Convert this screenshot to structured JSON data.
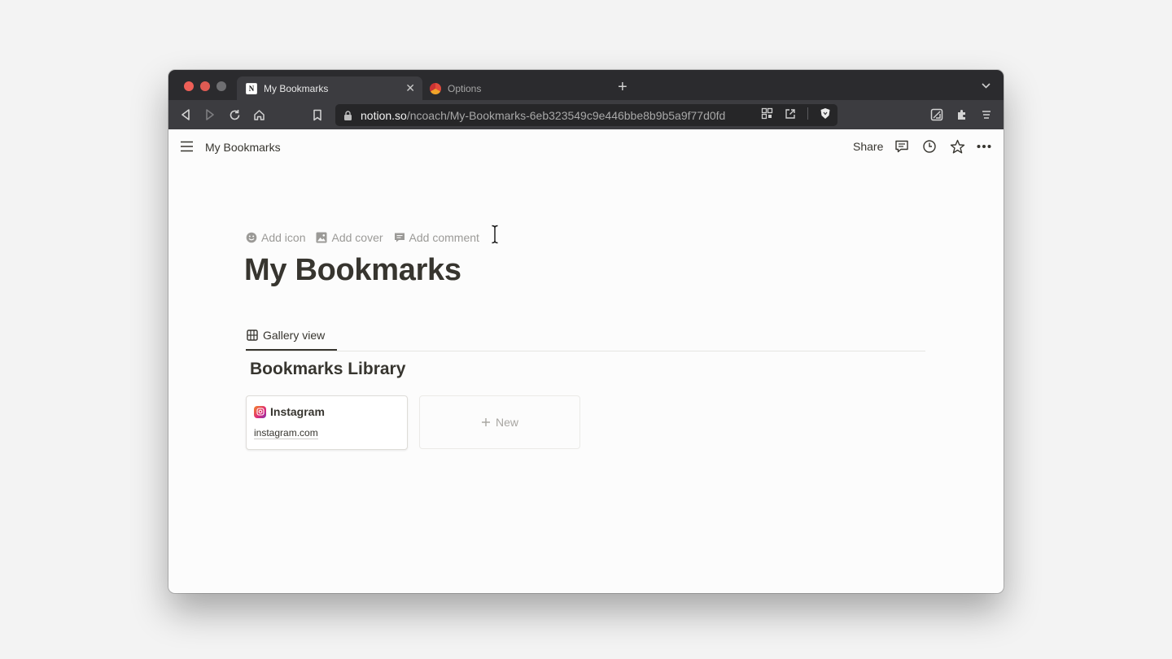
{
  "browser": {
    "tabs": [
      {
        "title": "My Bookmarks",
        "active": true,
        "favicon": "notion-icon"
      },
      {
        "title": "Options",
        "active": false,
        "favicon": "options-icon"
      }
    ],
    "url": {
      "host": "notion.so",
      "path": "/ncoach/My-Bookmarks-6eb323549c9e446bbe8b9b5a9f77d0fd"
    },
    "new_tab_label": "+"
  },
  "topbar": {
    "breadcrumb": "My Bookmarks",
    "share_label": "Share"
  },
  "page": {
    "actions": [
      {
        "label": "Add icon",
        "icon": "smiley-icon"
      },
      {
        "label": "Add cover",
        "icon": "image-icon"
      },
      {
        "label": "Add comment",
        "icon": "comment-icon"
      }
    ],
    "title": "My Bookmarks",
    "view_tab": "Gallery view",
    "database_title": "Bookmarks Library",
    "cards": [
      {
        "title": "Instagram",
        "url": "instagram.com"
      }
    ],
    "new_label": "New"
  },
  "colors": {
    "text": "#37352f",
    "muted": "#9b9a97",
    "chrome_dark": "#2b2b2e",
    "toolbar": "#3c3c40",
    "close_red": "#ee5f57"
  }
}
